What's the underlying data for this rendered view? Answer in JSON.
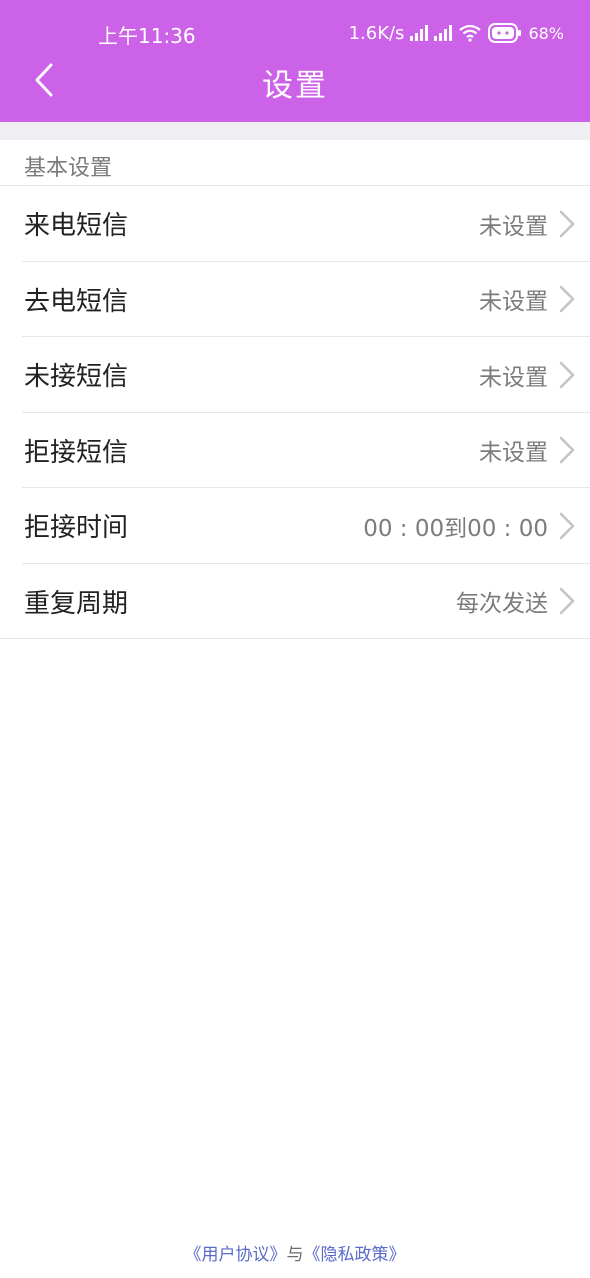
{
  "status_bar": {
    "time": "上午11:36",
    "net_speed": "1.6K/s",
    "battery": "68%"
  },
  "header": {
    "title": "设置",
    "back_icon": "chevron-left-icon",
    "bg_color": "#cc62e8"
  },
  "section": {
    "label": "基本设置"
  },
  "rows": [
    {
      "label": "来电短信",
      "value": "未设置"
    },
    {
      "label": "去电短信",
      "value": "未设置"
    },
    {
      "label": "未接短信",
      "value": "未设置"
    },
    {
      "label": "拒接短信",
      "value": "未设置"
    },
    {
      "label": "拒接时间",
      "value": "00 : 00到00 : 00"
    },
    {
      "label": "重复周期",
      "value": "每次发送"
    }
  ],
  "footer": {
    "user_agreement": "《用户协议》",
    "connector": "与",
    "privacy_policy": "《隐私政策》",
    "link_color": "#5a6acb"
  }
}
